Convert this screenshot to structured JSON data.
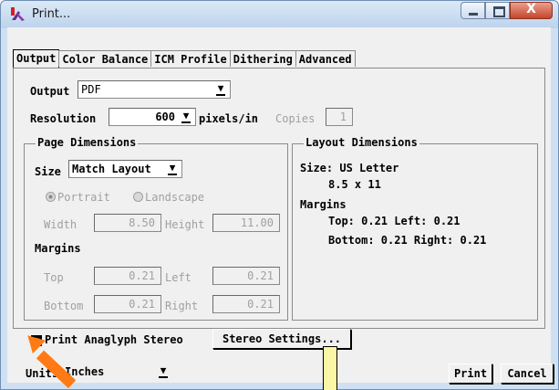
{
  "window": {
    "title": "Print...",
    "controls": {
      "close": "X"
    }
  },
  "tabs": [
    "Output",
    "Color Balance",
    "ICM Profile",
    "Dithering",
    "Advanced"
  ],
  "output": {
    "label": "Output",
    "value": "PDF"
  },
  "resolution": {
    "label": "Resolution",
    "value": "600",
    "units": "pixels/in",
    "copies_label": "Copies",
    "copies_value": "1"
  },
  "page_dimensions": {
    "title": "Page Dimensions",
    "size_label": "Size",
    "size_value": "Match Layout",
    "portrait": "Portrait",
    "landscape": "Landscape",
    "width_label": "Width",
    "width_value": "8.50",
    "height_label": "Height",
    "height_value": "11.00",
    "margins_label": "Margins",
    "top_label": "Top",
    "top_value": "0.21",
    "left_label": "Left",
    "left_value": "0.21",
    "bottom_label": "Bottom",
    "bottom_value": "0.21",
    "right_label": "Right",
    "right_value": "0.21"
  },
  "layout_dimensions": {
    "title": "Layout Dimensions",
    "size_line": "Size: US Letter",
    "size_detail": "8.5 x 11",
    "margins_label": "Margins",
    "margins_line1": "Top: 0.21  Left: 0.21",
    "margins_line2": "Bottom: 0.21  Right: 0.21"
  },
  "stereo": {
    "checkbox_label": "Print Anaglyph Stereo",
    "settings_button": "Stereo Settings..."
  },
  "units": {
    "label": "Units",
    "value": "Inches"
  },
  "buttons": {
    "print": "Print",
    "cancel": "Cancel"
  },
  "colors": {
    "accent_arrow": "#ff7a14",
    "callout": "#fbf6a6"
  }
}
